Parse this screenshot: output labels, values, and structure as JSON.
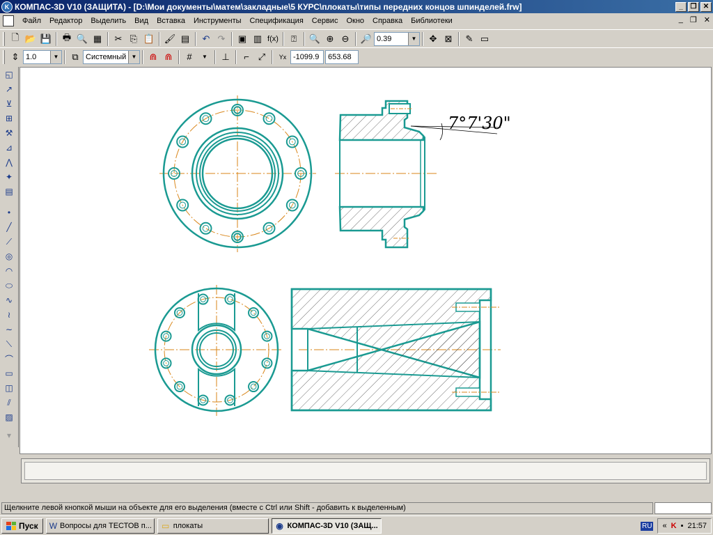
{
  "window": {
    "title": "КОМПАС-3D V10 (ЗАЩИТА) - [D:\\Мои документы\\матем\\закладные\\5 КУРС\\плокаты\\типы передних концов шпинделей.frw]",
    "minimize": "_",
    "restore": "❐",
    "close": "✕",
    "doc_minimize": "_",
    "doc_restore": "❐",
    "doc_close": "✕"
  },
  "menu": {
    "items": [
      "Файл",
      "Редактор",
      "Выделить",
      "Вид",
      "Вставка",
      "Инструменты",
      "Спецификация",
      "Сервис",
      "Окно",
      "Справка",
      "Библиотеки"
    ]
  },
  "toolbar1": {
    "zoom_value": "0.39",
    "fx_label": "f(x)"
  },
  "toolbar2": {
    "step_value": "1.0",
    "layer_value": "Системный",
    "coord_x": "-1099.9",
    "coord_y": "653.68"
  },
  "drawing": {
    "angle_label": "7°7'30\"",
    "line_color": "#1a9a92",
    "axis_color": "#d9861a",
    "hatch_color": "#333333"
  },
  "status": {
    "message": "Щелкните левой кнопкой мыши на объекте для его выделения (вместе с Ctrl или Shift - добавить к выделенным)"
  },
  "taskbar": {
    "start_label": "Пуск",
    "tasks": [
      "Вопросы для ТЕСТОВ п...",
      "плокаты",
      "КОМПАС-3D V10 (ЗАЩ..."
    ],
    "lang": "RU",
    "clock": "21:57"
  }
}
